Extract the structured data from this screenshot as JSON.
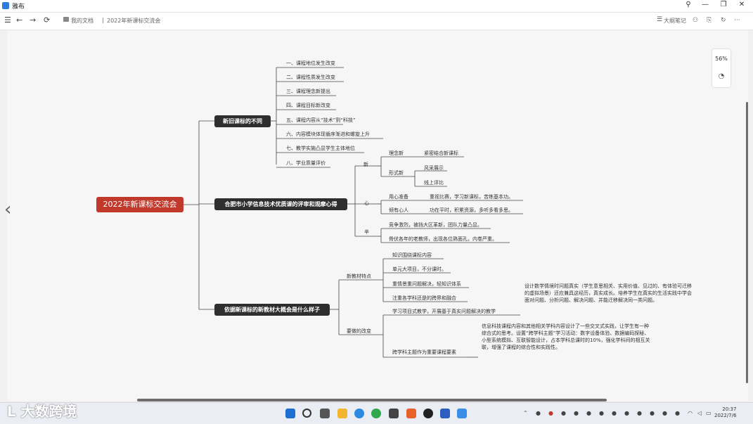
{
  "window": {
    "title": "雅布",
    "controls": {
      "pin": "⚲",
      "minimize": "—",
      "maximize": "❐",
      "close": "✕"
    }
  },
  "toolbar": {
    "menu": "☰",
    "back": "←",
    "forward": "→",
    "refresh": "⟳",
    "breadcrumb_home": "我的文档",
    "breadcrumb_sep": "|",
    "doc_title": "2022年新课标交流会",
    "outline": "大纲笔记",
    "more": "···"
  },
  "zoom": {
    "level": "56%"
  },
  "mindmap": {
    "root": "2022年新课标交流会",
    "b1": {
      "label": "新旧课标的不同",
      "items": [
        "一、课程地位发生改变",
        "二、课程性质发生改变",
        "三、课程理念新提出",
        "四、课程目标新改变",
        "五、课程内容从“技术”到“科技”",
        "六、内容模块体现循序渐进和螺旋上升",
        "七、教学实施凸显学生主体地位",
        "八、学业质量评价"
      ]
    },
    "b2": {
      "label": "合肥市小学信息技术优质课的评审和观摩心得",
      "xin": "新",
      "xin_items": [
        "理念新",
        "形式新"
      ],
      "xin_a": "紧密结合新课标",
      "xin_b": [
        "风采展示",
        "线上评比"
      ],
      "heart": "心",
      "heart_items": [
        "用心准备",
        "倾有心人"
      ],
      "heart_a": "重视比赛，学习新课标，苦练基本功。",
      "heart_b": "功在平时，积累资源，多听多看多思。",
      "xin2": "辛",
      "xin2_items": [
        "竞争激烈，被挡大区革新，团队力量凸显。",
        "骨伏各年的老教师，出现各位熟面孔，内卷严重。"
      ]
    },
    "b3": {
      "label": "依据新课标的新教材大概会是什么样子",
      "f1": "新教材特点",
      "f1_items": [
        "知识围绕课标内容",
        "单元大项目，不分课时。",
        "重情景重问题解决，轻知识体系",
        "注重各学科还是的跨界和融合"
      ],
      "f2": "要做的改变",
      "f2_a": "学习项目式教学，开展基于真实问题解决的教学",
      "f2_a_note": "设计数学情境时问题真实（学生意思相关、实用价值、见过的、有体验可迁移的虚拟场景）还应兼具这经历，真实成长。培养学生在真实的生活实践中学会面对问题、分析问题、解决问题、并能迁移解决同一类问题。",
      "f2_b": "跨学科主题作为重要课程要素",
      "f2_b_note": "信息科技课程内容和其他相关学科内容设计了一些交叉式实践，让学生有一种综合式的思考。设置“跨学科主题”学习活动：数字设备体验、数据编码探秘、小型系统模拟、互联智能设计，占本学科总课时的10%，强化学科间的相互关联，增强了课程的综合性和实践性。"
    }
  },
  "taskbar": {
    "clock_time": "20:37",
    "clock_date": "2022/7/6"
  },
  "watermark": "大数跨境",
  "colors": {
    "root": "#c0392b",
    "branch": "#2e2e2e",
    "line": "#444444"
  }
}
